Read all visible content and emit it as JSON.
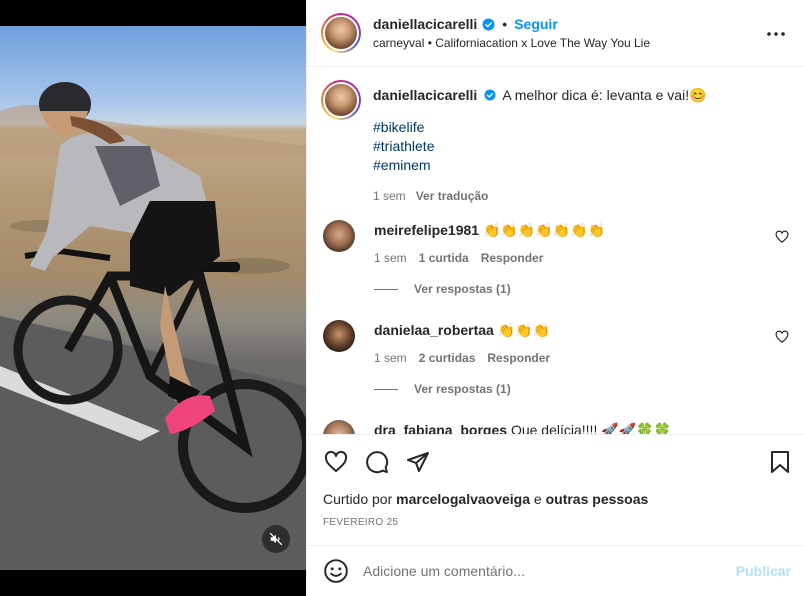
{
  "post": {
    "author": "daniellacicarelli",
    "follow_label": "Seguir",
    "dot": "•",
    "audio": "carneyval • Californiacation x Love The Way You Lie"
  },
  "caption": {
    "username": "daniellacicarelli",
    "text": "A melhor dica é: levanta e vai!😊",
    "hashtags": [
      "#bikelife",
      "#triathlete",
      "#eminem"
    ],
    "time": "1 sem",
    "translate_label": "Ver tradução"
  },
  "comments": [
    {
      "username": "meirefelipe1981",
      "text": "👏👏👏👏👏👏👏",
      "time": "1 sem",
      "likes": "1 curtida",
      "reply_label": "Responder",
      "view_replies": "Ver respostas (1)"
    },
    {
      "username": "danielaa_robertaa",
      "text": "👏👏👏",
      "time": "1 sem",
      "likes": "2 curtidas",
      "reply_label": "Responder",
      "view_replies": "Ver respostas (1)"
    },
    {
      "username": "dra_fabiana_borges",
      "text": "Que delícia!!!! 🚀🚀🍀🍀"
    }
  ],
  "likes": {
    "prefix": "Curtido por",
    "user": "marcelogalvaoveiga",
    "connector": "e",
    "suffix": "outras pessoas"
  },
  "date": "FEVEREIRO 25",
  "add_comment": {
    "placeholder": "Adicione um comentário...",
    "publish_label": "Publicar"
  },
  "colors": {
    "link_blue": "#0095f6",
    "hashtag": "#00376b",
    "secondary_text": "#737373",
    "publish_disabled": "#b2dffc"
  },
  "icons": [
    "verified-badge-icon",
    "more-options-icon",
    "heart-icon",
    "comment-icon",
    "share-icon",
    "bookmark-icon",
    "emoji-icon",
    "muted-speaker-icon"
  ]
}
